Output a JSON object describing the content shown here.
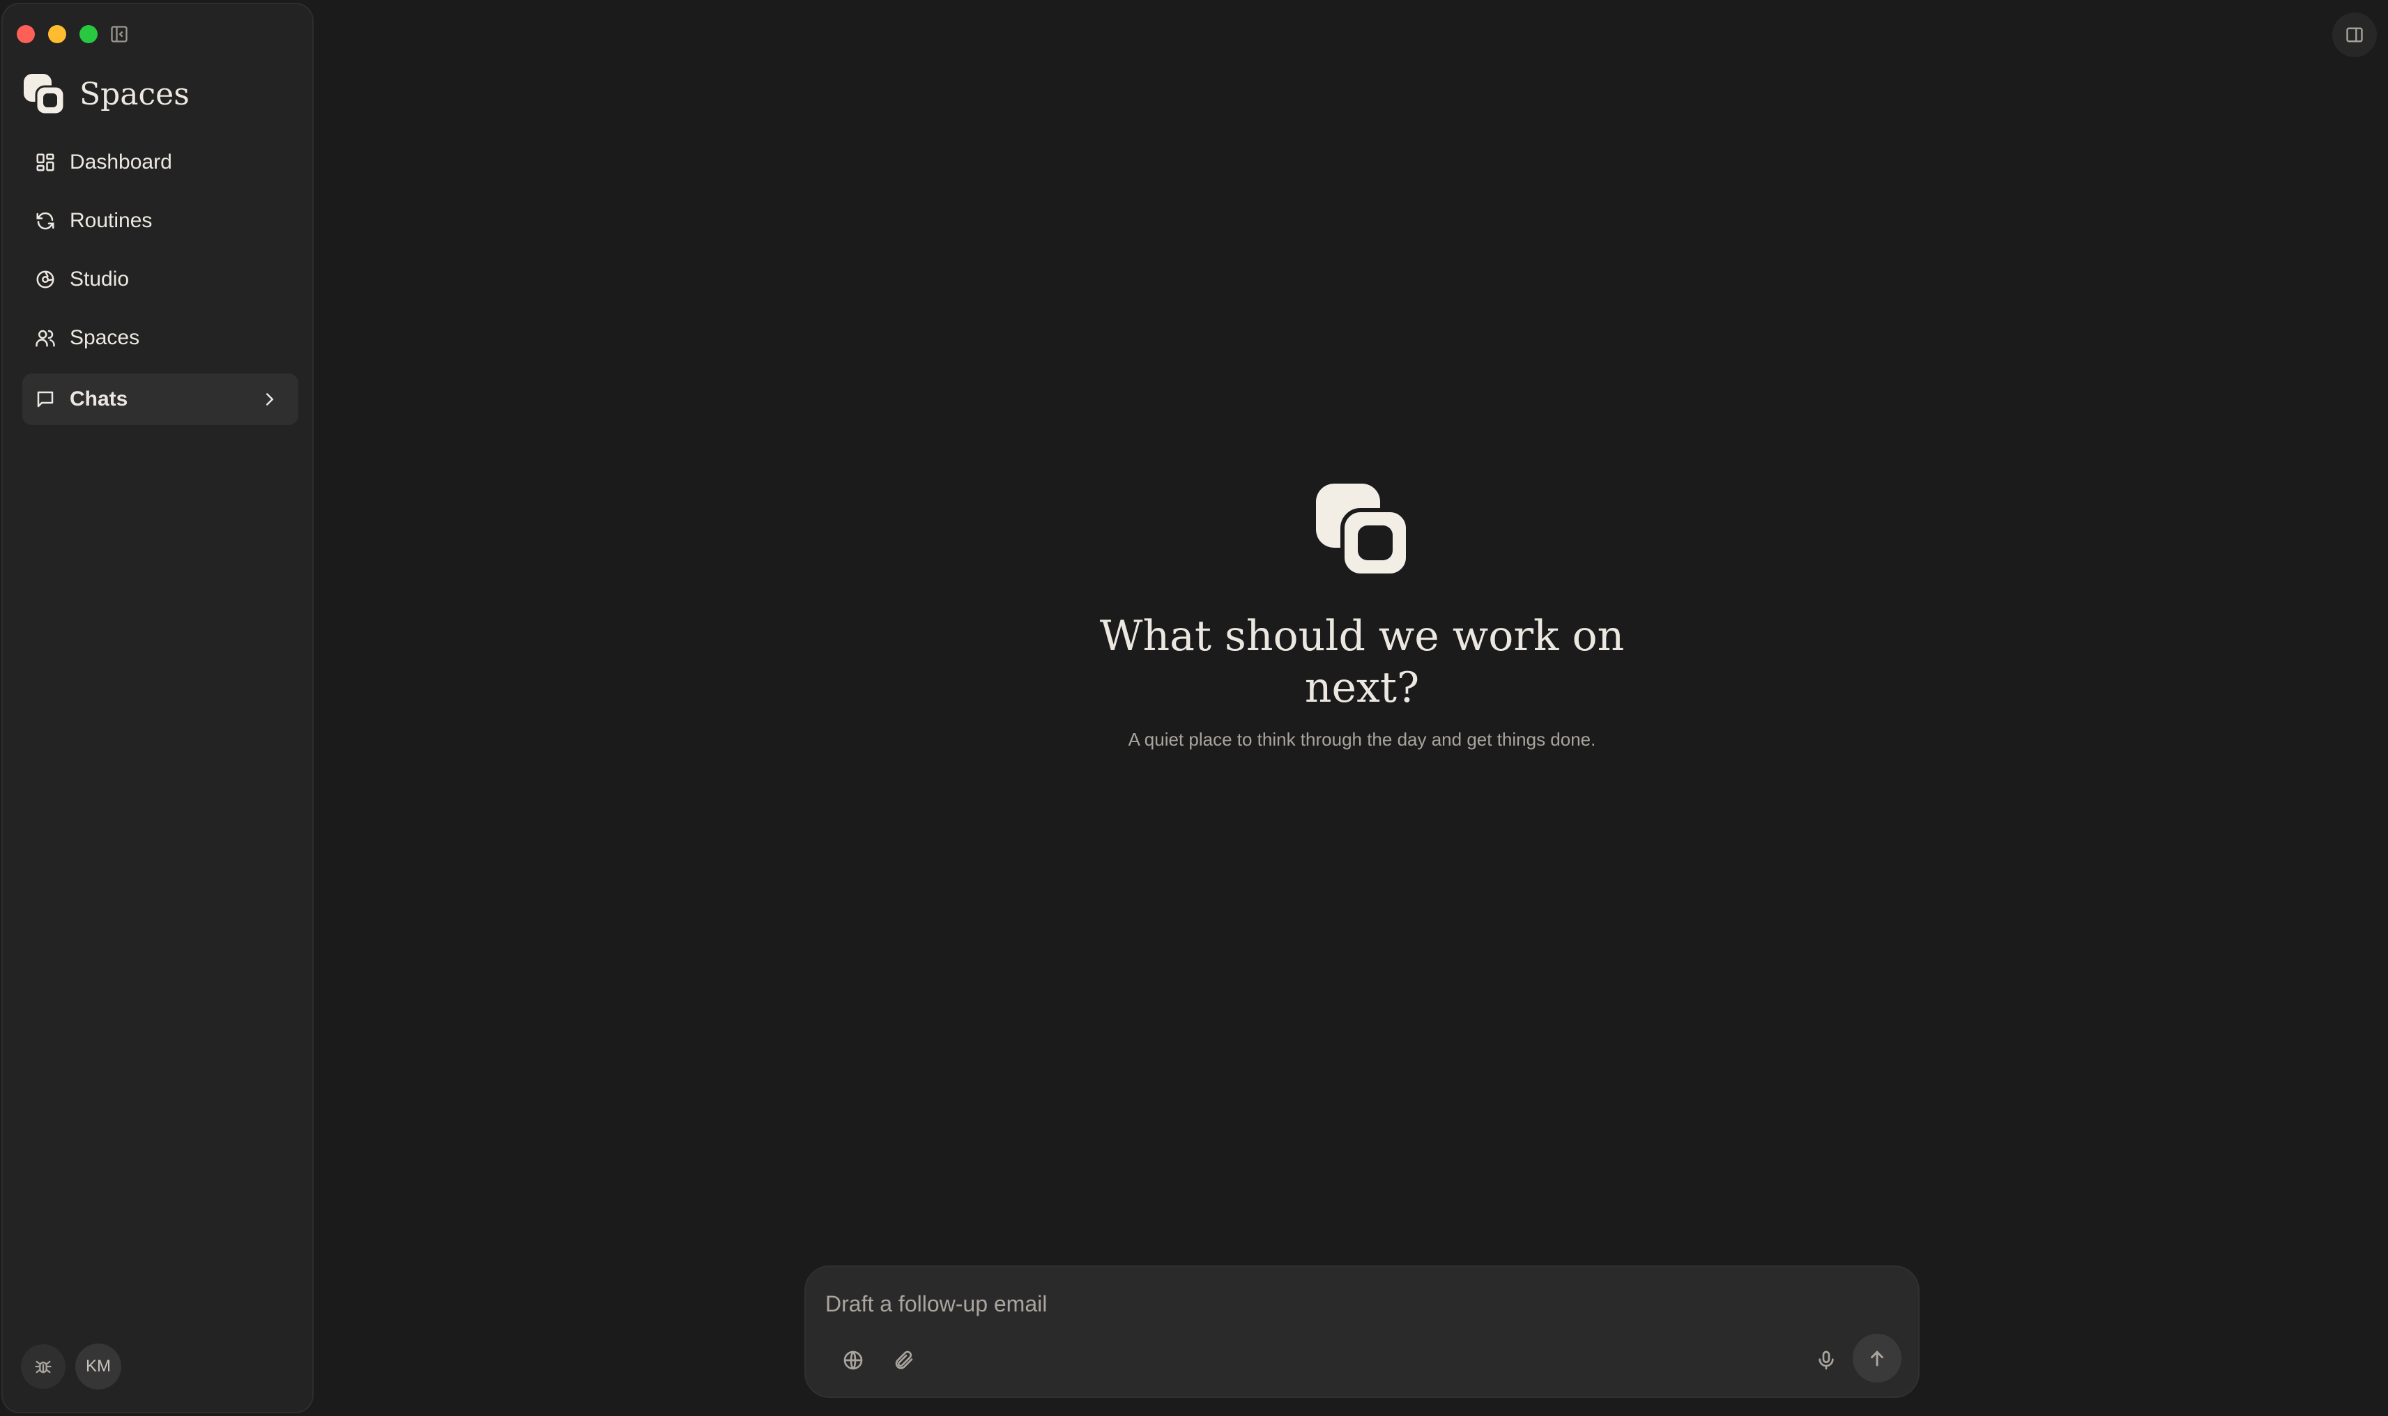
{
  "app": {
    "name": "Spaces"
  },
  "sidebar": {
    "items": [
      {
        "label": "Dashboard",
        "icon": "dashboard-grid-icon"
      },
      {
        "label": "Routines",
        "icon": "refresh-icon"
      },
      {
        "label": "Studio",
        "icon": "studio-aperture-icon"
      },
      {
        "label": "Spaces",
        "icon": "people-icon"
      }
    ],
    "active_item": {
      "label": "Chats",
      "icon": "chat-bubble-icon"
    },
    "bottom": {
      "debug_icon": "bug-icon",
      "avatar_initials": "KM"
    }
  },
  "hero": {
    "title": "What should we work on next?",
    "subtitle": "A quiet place to think through the day and get things done."
  },
  "composer": {
    "value": "",
    "placeholder": "Draft a follow-up email",
    "tools": [
      "globe-icon",
      "paperclip-icon",
      "microphone-icon",
      "arrow-up-icon"
    ]
  },
  "colors": {
    "background": "#1b1b1b",
    "sidebar": "#232323",
    "text": "#ece8e1",
    "muted": "#a9a59e",
    "traffic_red": "#fe5f57",
    "traffic_yellow": "#febc2e",
    "traffic_green": "#28c840"
  }
}
